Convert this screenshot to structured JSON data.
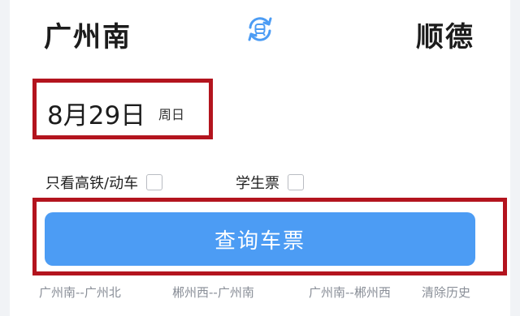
{
  "route": {
    "from_station": "广州南",
    "to_station": "顺德",
    "swap_icon": "swap-icon"
  },
  "date": {
    "text": "8月29日",
    "weekday": "周日"
  },
  "options": {
    "high_speed_only": "只看高铁/动车",
    "student_ticket": "学生票"
  },
  "query_button": "查询车票",
  "history": {
    "items": [
      "广州南--广州北",
      "郴州西--广州南",
      "广州南--郴州西"
    ],
    "clear": "清除历史"
  },
  "colors": {
    "accent": "#4c9cf4",
    "highlight": "#b3141e"
  }
}
